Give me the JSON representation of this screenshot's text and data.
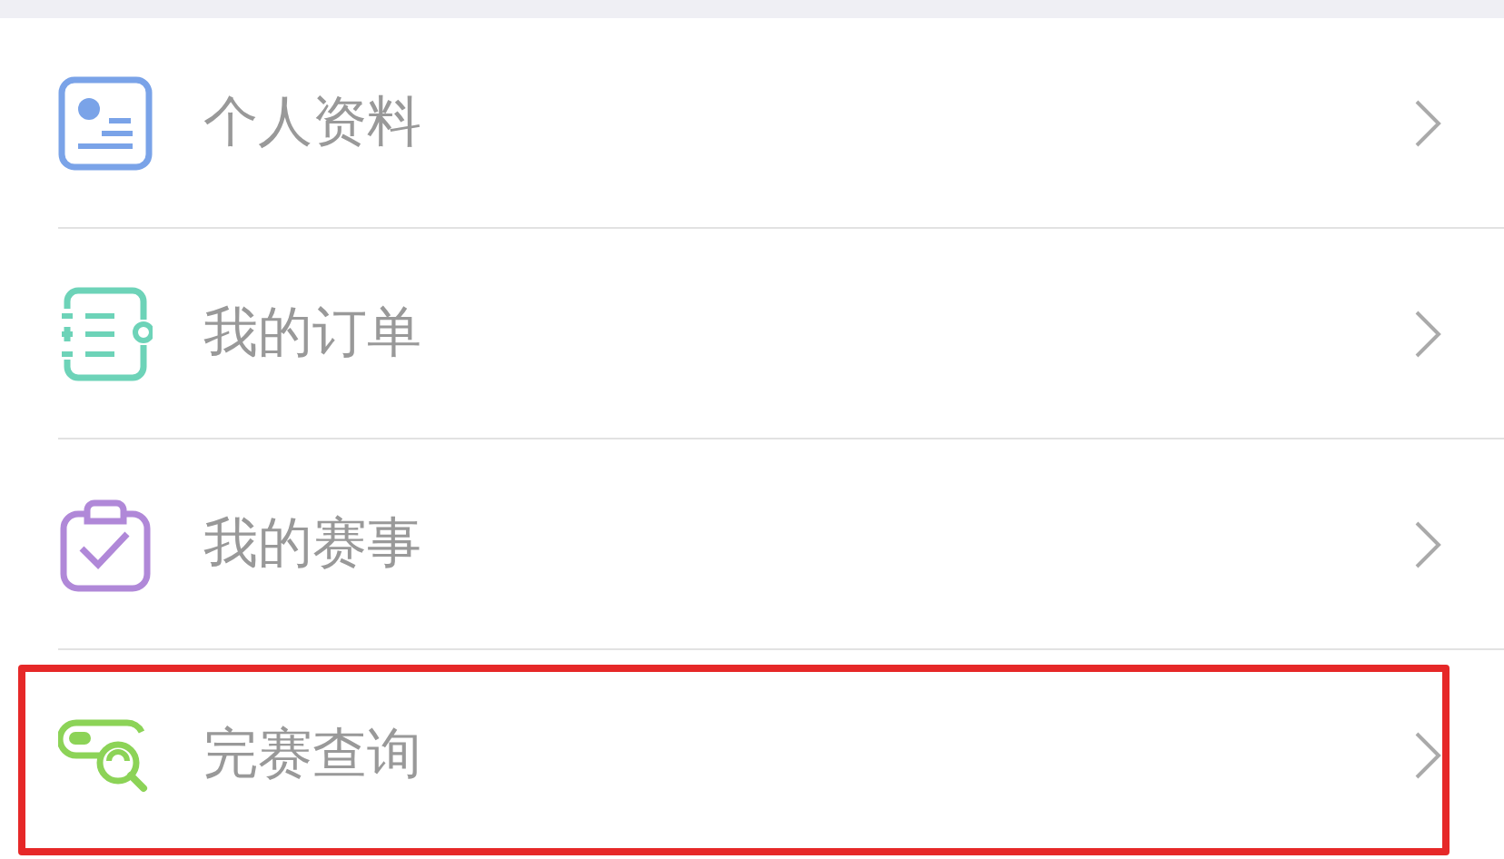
{
  "menu": [
    {
      "kind": "profile",
      "label": "个人资料",
      "highlighted": false
    },
    {
      "kind": "orders",
      "label": "我的订单",
      "highlighted": false
    },
    {
      "kind": "events",
      "label": "我的赛事",
      "highlighted": false
    },
    {
      "kind": "results",
      "label": "完赛查询",
      "highlighted": true
    }
  ]
}
